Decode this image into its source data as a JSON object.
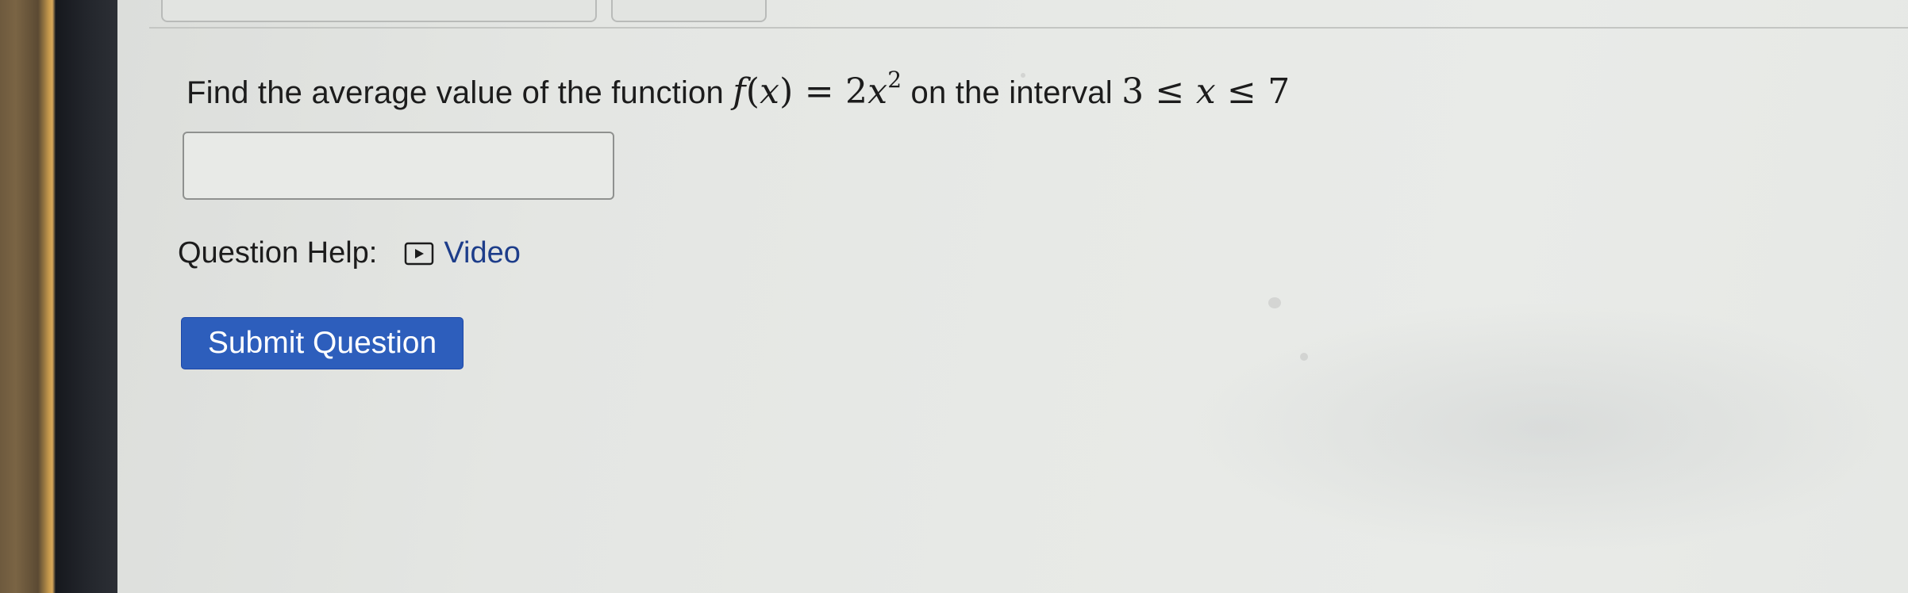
{
  "question": {
    "prefix": "Find the average value of the function",
    "function_lhs_name": "f",
    "function_lhs_var": "x",
    "equals": "=",
    "coefficient": "2",
    "variable": "x",
    "exponent": "2",
    "middle": "on the interval",
    "lower_bound": "3",
    "leq_1": "≤",
    "interval_var": "x",
    "leq_2": "≤",
    "upper_bound": "7"
  },
  "answer": {
    "value": "",
    "placeholder": ""
  },
  "help": {
    "label": "Question Help:",
    "video_label": "Video",
    "video_icon": "play-icon"
  },
  "submit": {
    "label": "Submit Question"
  },
  "colors": {
    "submit_bg": "#2d5ebc",
    "link": "#1d3d8a",
    "screen_bg": "#e6e8e5"
  }
}
